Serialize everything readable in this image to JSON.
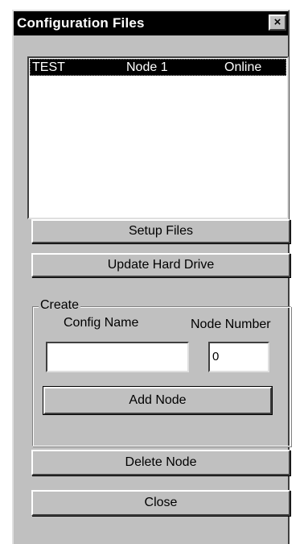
{
  "window": {
    "title": "Configuration Files",
    "close_glyph": "×"
  },
  "nodes_list": [
    {
      "name": "TEST",
      "node": "Node 1",
      "status": "Online"
    }
  ],
  "buttons": {
    "setup_files": "Setup Files",
    "update_hard_drive": "Update Hard Drive",
    "add_node": "Add Node",
    "delete_node": "Delete Node",
    "close": "Close"
  },
  "create_group": {
    "label": "Create",
    "config_name_label": "Config Name",
    "config_name_value": "",
    "node_number_label": "Node Number",
    "node_number_value": "0"
  }
}
